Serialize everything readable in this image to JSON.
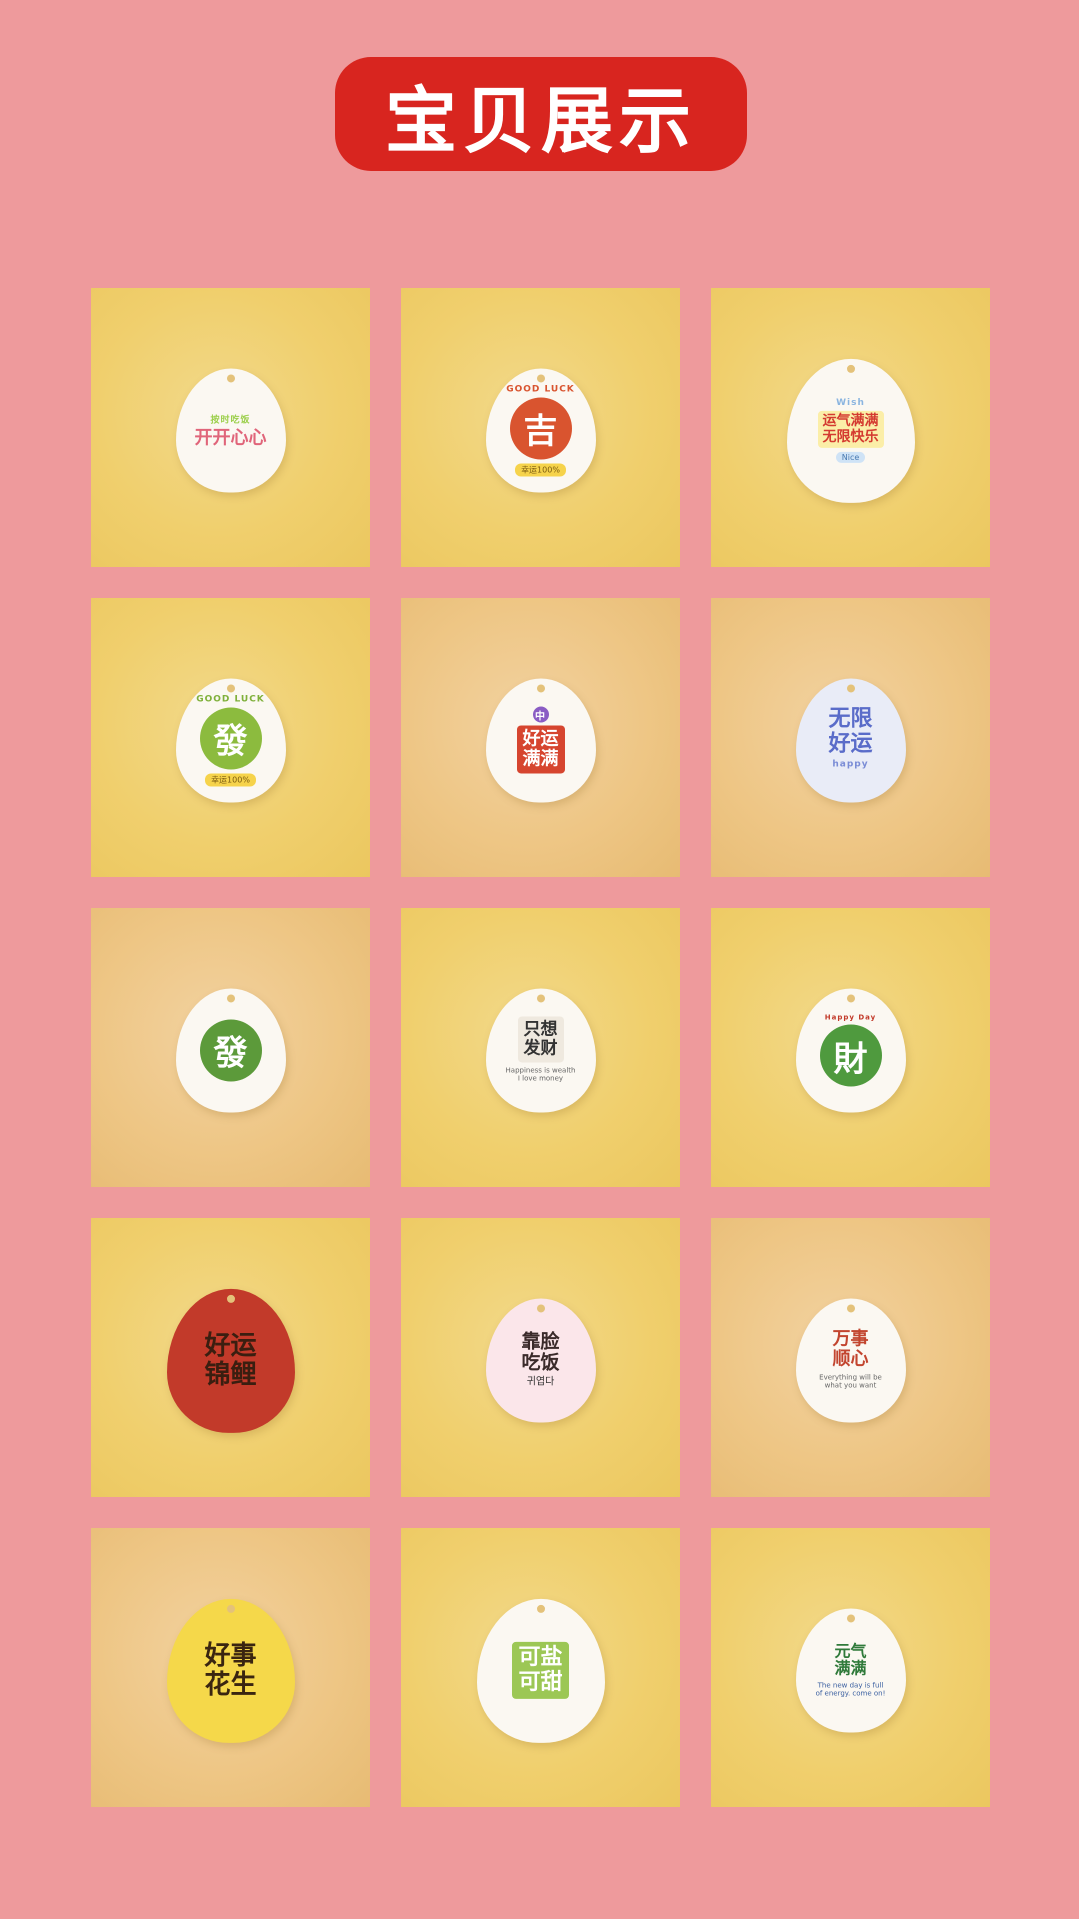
{
  "header": {
    "title": "宝贝展示"
  },
  "colors": {
    "background": "#ee9a9c",
    "title_pill": "#d8251f"
  },
  "products": [
    {
      "main": "开开心心",
      "top": "按时吃饭"
    },
    {
      "main": "吉",
      "top": "GOOD LUCK",
      "chip": "幸运100%"
    },
    {
      "main": "运气满满\n无限快乐",
      "top": "Wish",
      "chip": "Nice"
    },
    {
      "main": "發",
      "top": "GOOD LUCK",
      "chip": "幸运100%"
    },
    {
      "main": "好运\n满满",
      "top": "中"
    },
    {
      "main": "无限\n好运",
      "top": "happy"
    },
    {
      "main": "發",
      "top": ""
    },
    {
      "main": "只想\n发财",
      "sub": "Happiness is wealth\nI love money"
    },
    {
      "main": "財",
      "top": "Happy Day"
    },
    {
      "main": "好运\n锦鲤"
    },
    {
      "main": "靠脸\n吃饭",
      "sub": "귀엽다"
    },
    {
      "main": "万事\n顺心",
      "sub": "Everything will be\nwhat you want"
    },
    {
      "main": "好事\n花生"
    },
    {
      "main": "可盐\n可甜"
    },
    {
      "main": "元气\n满满",
      "sub": "The new day is full\nof energy. come on!"
    }
  ]
}
